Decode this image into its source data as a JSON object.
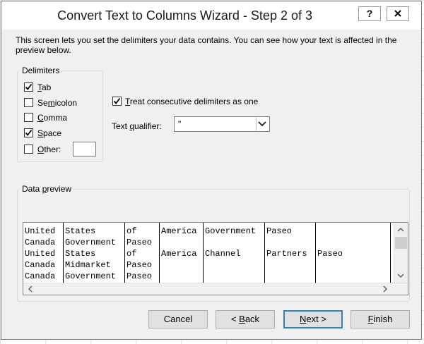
{
  "dialog": {
    "title": "Convert Text to Columns Wizard - Step 2 of 3",
    "help_label": "?",
    "close_label": "X",
    "description": "This screen lets you set the delimiters your data contains.  You can see how your text is affected in the preview below."
  },
  "delimiters": {
    "group_label": "Delimiters",
    "tab": {
      "label": "Tab",
      "checked": true
    },
    "semicolon": {
      "label": "Semicolon",
      "checked": false
    },
    "comma": {
      "label": "Comma",
      "checked": false
    },
    "space": {
      "label": "Space",
      "checked": true
    },
    "other": {
      "label": "Other:",
      "checked": false,
      "value": ""
    }
  },
  "options": {
    "consecutive": {
      "label": "Treat consecutive delimiters as one",
      "checked": true
    },
    "qualifier_label": "Text qualifier:",
    "qualifier_value": "\""
  },
  "preview": {
    "label": "Data preview",
    "columns": [
      [
        "United",
        "Canada",
        "United",
        "Canada",
        "Canada"
      ],
      [
        "States",
        "Government",
        "States",
        "Midmarket",
        "Government"
      ],
      [
        "of",
        "Paseo",
        "of",
        "Paseo",
        "Paseo"
      ],
      [
        "America",
        "",
        "America",
        "",
        ""
      ],
      [
        "Government",
        "",
        "Channel",
        "",
        ""
      ],
      [
        "Paseo",
        "",
        "Partners",
        "",
        ""
      ],
      [
        "",
        "",
        "Paseo",
        "",
        ""
      ]
    ]
  },
  "buttons": {
    "cancel": "Cancel",
    "back": "< Back",
    "next": "Next >",
    "finish": "Finish"
  }
}
